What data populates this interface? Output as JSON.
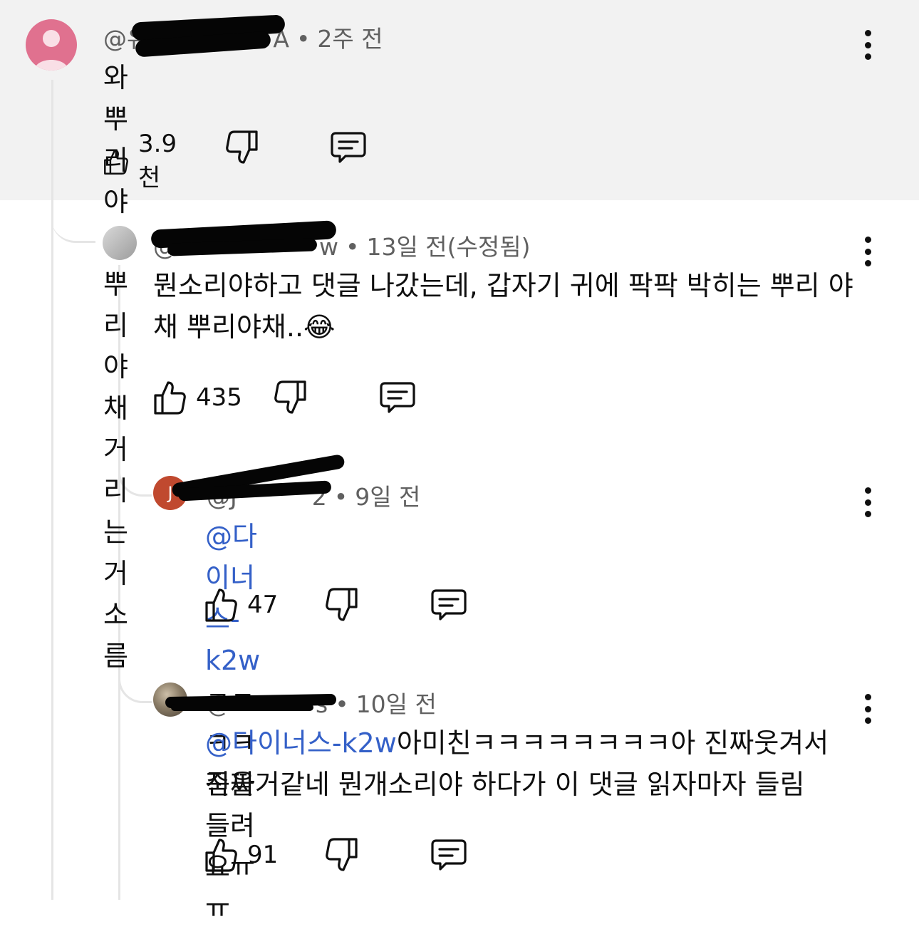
{
  "colors": {
    "top_background": "#f2f2f2",
    "mention": "#3460c8",
    "meta": "#606060"
  },
  "comments": [
    {
      "handle": "@유",
      "handle_tail": "A",
      "time": "2주 전",
      "text": "와 뿌리야채 뿌리야채 거리는거 소름",
      "likes": "3.9천",
      "avatar_icon": "person-icon"
    },
    {
      "handle": "@",
      "handle_tail": "w",
      "time": "13일 전(수정됨)",
      "text": "뭔소리야하고 댓글 나갔는데, 갑자기 귀에 팍팍 박히는 뿌리 야채 뿌리야채..",
      "emoji": "😂",
      "likes": "435"
    },
    {
      "handle": "@J",
      "handle_tail": "2",
      "avatar_letter": "J",
      "time": "9일 전",
      "mention": "@다이너스-k2w",
      "text": "ㅋㅋㅋㅋ진짜들려요ㅠㅠ",
      "likes": "47"
    },
    {
      "handle": "@",
      "handle_tail": "s",
      "time": "10일 전",
      "mention": "@다이너스-k2w",
      "text": "아미친ㅋㅋㅋㅋㅋㅋㅋㅋ아 진짜웃겨서 죽을거같네 뭔개소리야 하다가 이 댓글 읽자마자 들림",
      "likes": "91"
    }
  ],
  "icons": {
    "like": "thumbs-up-icon",
    "dislike": "thumbs-down-icon",
    "reply": "reply-comment-icon",
    "more": "more-vertical-icon"
  }
}
